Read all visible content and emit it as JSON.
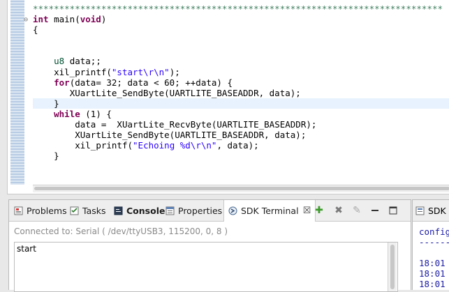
{
  "editor": {
    "top_line": "******************************************************************************",
    "lines": [
      {
        "pre": "",
        "tokens": [
          {
            "t": "int",
            "c": "kw"
          },
          {
            "t": " main("
          },
          {
            "t": "void",
            "c": "kw"
          },
          {
            "t": ")"
          }
        ],
        "fold": true
      },
      {
        "pre": "",
        "tokens": [
          {
            "t": "{"
          }
        ]
      },
      {
        "pre": "",
        "tokens": []
      },
      {
        "pre": "",
        "tokens": []
      },
      {
        "pre": "    ",
        "tokens": [
          {
            "t": "u8",
            "c": "ty"
          },
          {
            "t": " data;;"
          }
        ]
      },
      {
        "pre": "    ",
        "tokens": [
          {
            "t": "xil_printf("
          },
          {
            "t": "\"start\\r\\n\"",
            "c": "str"
          },
          {
            "t": ");"
          }
        ]
      },
      {
        "pre": "    ",
        "tokens": [
          {
            "t": "for",
            "c": "kw"
          },
          {
            "t": "(data= 32; data < 60; ++data) {"
          }
        ]
      },
      {
        "pre": "       ",
        "tokens": [
          {
            "t": "XUartLite_SendByte(UARTLITE_BASEADDR, data);"
          }
        ]
      },
      {
        "pre": "    ",
        "tokens": [
          {
            "t": "}"
          }
        ],
        "current": true
      },
      {
        "pre": "    ",
        "tokens": [
          {
            "t": "while",
            "c": "kw"
          },
          {
            "t": " (1) {"
          }
        ]
      },
      {
        "pre": "        ",
        "tokens": [
          {
            "t": "data =  XUartLite_RecvByte(UARTLITE_BASEADDR);"
          }
        ]
      },
      {
        "pre": "        ",
        "tokens": [
          {
            "t": "XUartLite_SendByte(UARTLITE_BASEADDR, data);"
          }
        ]
      },
      {
        "pre": "        ",
        "tokens": [
          {
            "t": "xil_printf("
          },
          {
            "t": "\"Echoing %d\\r\\n\"",
            "c": "str"
          },
          {
            "t": ", data);"
          }
        ]
      },
      {
        "pre": "    ",
        "tokens": [
          {
            "t": "}"
          }
        ]
      }
    ]
  },
  "tabs": {
    "problems": "Problems",
    "tasks": "Tasks",
    "console": "Console",
    "properties": "Properties",
    "sdk_terminal": "SDK Terminal",
    "close_glyph": "☒"
  },
  "terminal": {
    "status": "Connected to: Serial (  /dev/ttyUSB3, 115200, 0, 8 )",
    "output": "start"
  },
  "right_panel": {
    "tab": "SDK Log",
    "lines": [
      "config",
      "------",
      "",
      "18:01",
      "18:01",
      "18:01"
    ]
  },
  "colors": {
    "keyword": "#7f0055",
    "string": "#2a00ff",
    "type": "#005032",
    "log_text": "#1a1aa6"
  }
}
